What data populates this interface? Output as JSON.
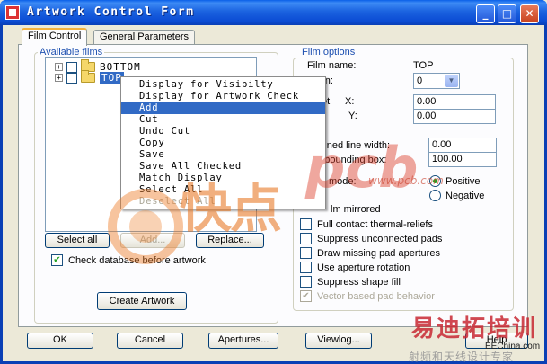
{
  "window": {
    "title": "Artwork Control Form",
    "min_glyph": "_",
    "max_glyph": "□",
    "close_glyph": "✕"
  },
  "tabs": [
    {
      "label": "Film Control",
      "active": true
    },
    {
      "label": "General Parameters",
      "active": false
    }
  ],
  "available_films": {
    "label": "Available films",
    "items": [
      {
        "name": "BOTTOM",
        "expand": "+",
        "checked": false,
        "selected": false
      },
      {
        "name": "TOP",
        "expand": "+",
        "checked": false,
        "selected": true
      }
    ],
    "buttons": {
      "select_all": "Select all",
      "add": "Add...",
      "replace": "Replace..."
    },
    "check_db_label": "Check database before artwork",
    "check_db_checked": true,
    "create_artwork": "Create Artwork"
  },
  "context_menu": {
    "items": [
      {
        "label": "Display for Visibilty",
        "state": "normal"
      },
      {
        "label": "Display for Artwork Check",
        "state": "normal"
      },
      {
        "label": "Add",
        "state": "highlighted"
      },
      {
        "label": "Cut",
        "state": "normal"
      },
      {
        "label": "Undo Cut",
        "state": "normal"
      },
      {
        "label": "Copy",
        "state": "normal"
      },
      {
        "label": "Save",
        "state": "normal"
      },
      {
        "label": "Save All Checked",
        "state": "normal"
      },
      {
        "label": "Match Display",
        "state": "normal"
      },
      {
        "label": "Select All",
        "state": "normal"
      },
      {
        "label": "Deselect All",
        "state": "disabled"
      }
    ]
  },
  "film_options": {
    "label": "Film options",
    "film_name_label": "Film name:",
    "film_name_value": "TOP",
    "rotation_label": "ation:",
    "rotation_value": "0",
    "offset_label": "et",
    "x_label": "X:",
    "y_label": "Y:",
    "x_value": "0.00",
    "y_value": "0.00",
    "undefined_line_width_label": "defined line width:",
    "undefined_line_width_value": "0.00",
    "shape_bounding_box_label": "pe bounding box:",
    "shape_bounding_box_value": "100.00",
    "plot_mode_label": "mode:",
    "positive_label": "Positive",
    "negative_label": "Negative",
    "film_mirrored_label": "lm mirrored",
    "checkboxes": [
      {
        "label": "Full contact thermal-reliefs",
        "checked": false,
        "disabled": false
      },
      {
        "label": "Suppress unconnected pads",
        "checked": false,
        "disabled": false
      },
      {
        "label": "Draw missing pad apertures",
        "checked": false,
        "disabled": false
      },
      {
        "label": "Use aperture rotation",
        "checked": false,
        "disabled": false
      },
      {
        "label": "Suppress shape fill",
        "checked": false,
        "disabled": false
      },
      {
        "label": "Vector based pad behavior",
        "checked": true,
        "disabled": true
      }
    ]
  },
  "footer": {
    "ok": "OK",
    "cancel": "Cancel",
    "apertures": "Apertures...",
    "viewlog": "Viewlog...",
    "help": "Help"
  },
  "watermark": {
    "cn_text": "快点",
    "pcb_text": "pcb",
    "url": "www.pcb.com",
    "brand_text": "易迪拓培训",
    "brand_site": "EEChina.com",
    "brand_sub": "射频和天线设计专家"
  },
  "colors": {
    "titlebar": "#0b4bd3",
    "tab_accent": "#f5b13d",
    "menu_highlight": "#316ac5",
    "group_label": "#1c4fb0"
  }
}
